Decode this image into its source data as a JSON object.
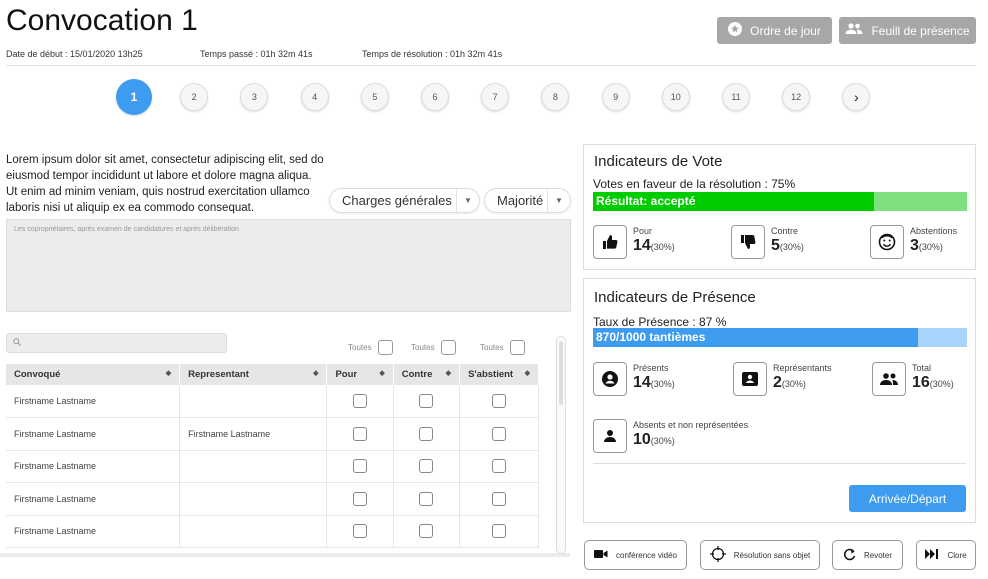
{
  "header": {
    "title": "Convocation 1",
    "date_debut": "Date de début : 15/01/2020 13h25",
    "temps_passe": "Temps passé : 01h 32m 41s",
    "temps_resolution": "Temps de résolution : 01h 32m 41s",
    "btn_ordre": "Ordre de jour",
    "btn_feuil": "Feuill de présence"
  },
  "steps": [
    "1",
    "2",
    "3",
    "4",
    "5",
    "6",
    "7",
    "8",
    "9",
    "10",
    "11",
    "12"
  ],
  "active_step": "1",
  "next_glyph": "›",
  "description": "Lorem ipsum dolor sit amet, consectetur adipiscing elit, sed do eiusmod tempor incididunt ut labore et dolore magna aliqua. Ut enim ad minim veniam, quis nostrud exercitation ullamco laboris nisi ut aliquip ex ea commodo consequat.",
  "dropdowns": {
    "charges": "Charges générales",
    "majorite": "Majorité"
  },
  "textarea_placeholder": "Les copropriétaires, après examen de candidatures et après délibération",
  "search_icon": "search-icon",
  "toutes": [
    "Toutes",
    "Toutes",
    "Toutes"
  ],
  "table": {
    "headers": [
      "Convoqué",
      "Representant",
      "Pour",
      "Contre",
      "S'abstient"
    ],
    "rows": [
      {
        "convoque": "Firstname Lastname",
        "representant": ""
      },
      {
        "convoque": "Firstname Lastname",
        "representant": "Firstname Lastname"
      },
      {
        "convoque": "Firstname Lastname",
        "representant": ""
      },
      {
        "convoque": "Firstname Lastname",
        "representant": ""
      },
      {
        "convoque": "Firstname Lastname",
        "representant": ""
      }
    ]
  },
  "vote": {
    "title": "Indicateurs de Vote",
    "sub": "Votes en faveur de la résolution : 75%",
    "bar_label": "Résultat: accepté",
    "bar_fraction": 0.75,
    "bar_color": "#00cc00",
    "bar_bg": "#7ee07e",
    "pour": {
      "label": "Pour",
      "value": "14",
      "pct": "(30%)"
    },
    "contre": {
      "label": "Contre",
      "value": "5",
      "pct": "(30%)"
    },
    "abst": {
      "label": "Abstentions",
      "value": "3",
      "pct": "(30%)"
    }
  },
  "presence": {
    "title": "Indicateurs de Présence",
    "sub": "Taux de Présence : 87 %",
    "bar_label": "870/1000 tantièmes",
    "bar_fraction": 0.87,
    "bar_color": "#3d9bf0",
    "bar_bg": "#a8d3fa",
    "presents": {
      "label": "Présents",
      "value": "14",
      "pct": "(30%)"
    },
    "representants": {
      "label": "Représentants",
      "value": "2",
      "pct": "(30%)"
    },
    "total": {
      "label": "Total",
      "value": "16",
      "pct": "(30%)"
    },
    "absents": {
      "label": "Absents et non représentées",
      "value": "10",
      "pct": "(30%)"
    },
    "btn_arrivee": "Arrivée/Départ"
  },
  "bottom": {
    "video": "conférence vidéo",
    "sans_objet": "Résolution sans objet",
    "revoter": "Revoter",
    "clore": "Clore"
  }
}
